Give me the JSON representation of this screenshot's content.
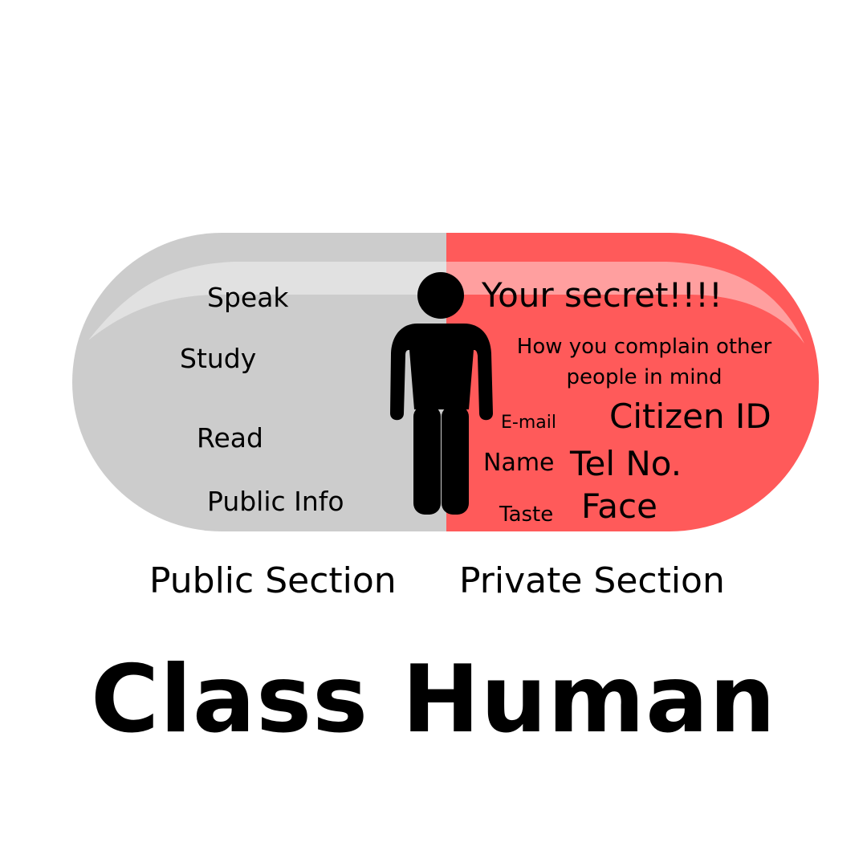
{
  "title": "Class Human",
  "colors": {
    "public": "#cccccc",
    "private": "#ff5a5a",
    "figure": "#000000"
  },
  "public_section": {
    "label": "Public Section",
    "items": [
      "Speak",
      "Study",
      "Read",
      "Public Info"
    ]
  },
  "private_section": {
    "label": "Private Section",
    "items": {
      "secret": "Your secret!!!!",
      "complain": "How you complain other people in mind",
      "email": "E-mail",
      "citizen_id": "Citizen ID",
      "name": "Name",
      "tel": "Tel No.",
      "taste": "Taste",
      "face": "Face"
    }
  },
  "figure_icon": "person-icon"
}
